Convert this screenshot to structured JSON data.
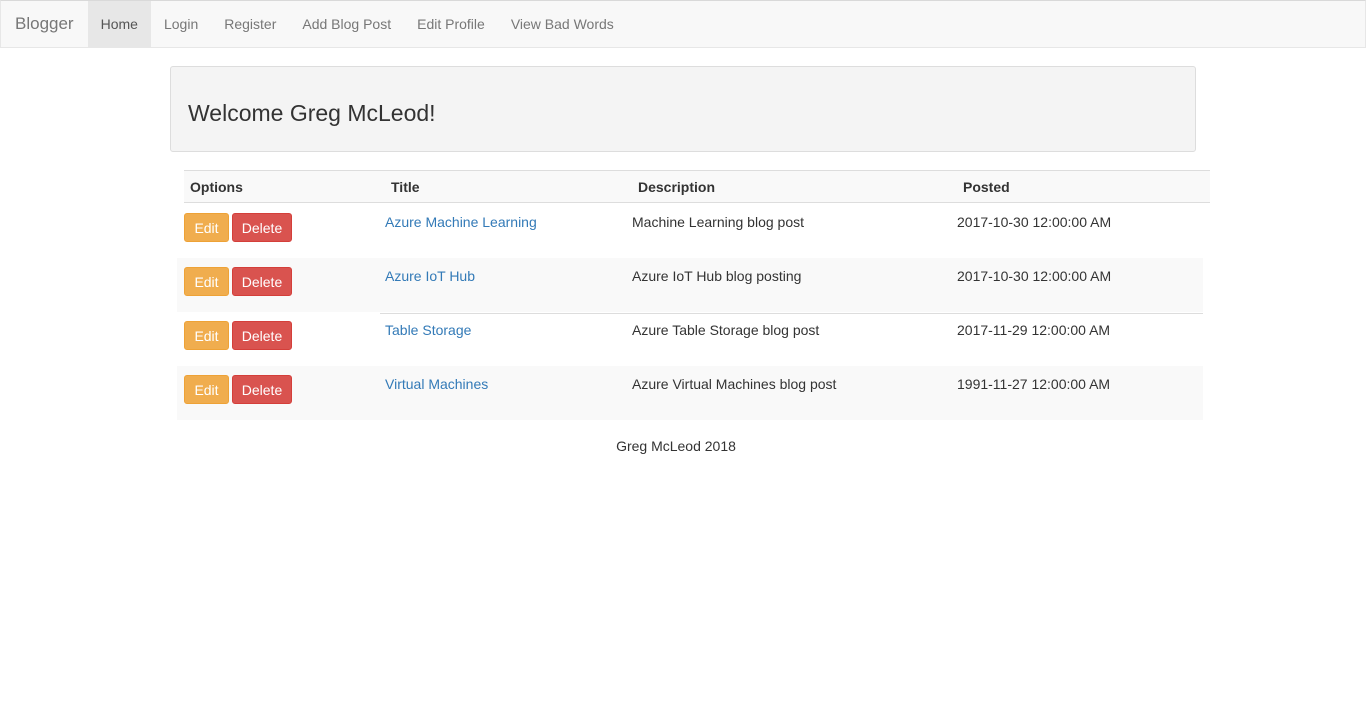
{
  "navbar": {
    "brand": "Blogger",
    "items": [
      {
        "label": "Home",
        "active": true
      },
      {
        "label": "Login",
        "active": false
      },
      {
        "label": "Register",
        "active": false
      },
      {
        "label": "Add Blog Post",
        "active": false
      },
      {
        "label": "Edit Profile",
        "active": false
      },
      {
        "label": "View Bad Words",
        "active": false
      }
    ]
  },
  "jumbotron": {
    "welcome": "Welcome Greg McLeod!"
  },
  "table": {
    "headers": {
      "options": "Options",
      "title": "Title",
      "description": "Description",
      "posted": "Posted"
    },
    "edit_label": "Edit",
    "delete_label": "Delete",
    "rows": [
      {
        "title": "Azure Machine Learning",
        "description": "Machine Learning blog post",
        "posted": "2017-10-30 12:00:00 AM"
      },
      {
        "title": "Azure IoT Hub",
        "description": "Azure IoT Hub blog posting",
        "posted": "2017-10-30 12:00:00 AM"
      },
      {
        "title": "Table Storage",
        "description": "Azure Table Storage blog post",
        "posted": "2017-11-29 12:00:00 AM"
      },
      {
        "title": "Virtual Machines",
        "description": "Azure Virtual Machines blog post",
        "posted": "1991-11-27 12:00:00 AM"
      }
    ]
  },
  "footer": {
    "text": "Greg McLeod 2018"
  },
  "colors": {
    "edit_button": "#f0ad4e",
    "delete_button": "#d9534f",
    "link": "#337ab7"
  }
}
